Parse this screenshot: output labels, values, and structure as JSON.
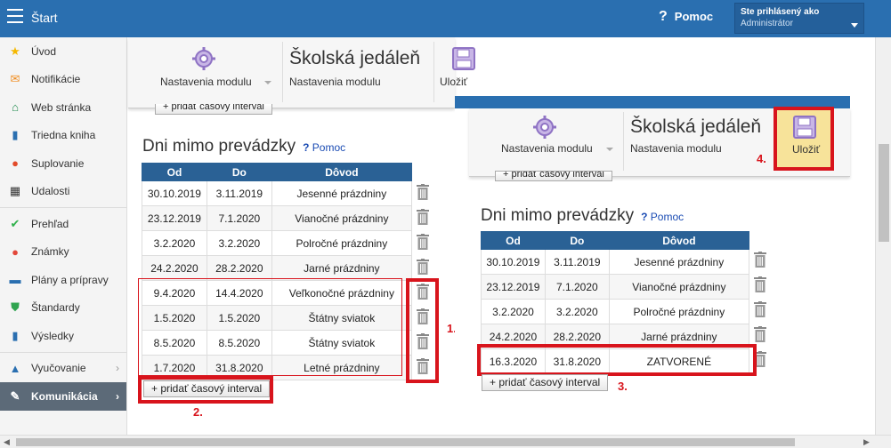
{
  "topbar": {
    "title": "Štart",
    "help_label": "Pomoc",
    "user_label": "Ste prihlásený ako",
    "user_name": "Administrátor"
  },
  "sidebar": {
    "items": [
      {
        "label": "Úvod",
        "icon": "star-icon"
      },
      {
        "label": "Notifikácie",
        "icon": "envelope-icon"
      },
      {
        "label": "Web stránka",
        "icon": "house-icon"
      },
      {
        "label": "Triedna kniha",
        "icon": "book-icon"
      },
      {
        "label": "Suplovanie",
        "icon": "person-icon"
      },
      {
        "label": "Udalosti",
        "icon": "calendar-icon"
      },
      {
        "label": "Prehľad",
        "icon": "check-circle-icon"
      },
      {
        "label": "Známky",
        "icon": "grade-icon"
      },
      {
        "label": "Plány a prípravy",
        "icon": "briefcase-icon"
      },
      {
        "label": "Štandardy",
        "icon": "shield-icon"
      },
      {
        "label": "Výsledky",
        "icon": "bar-chart-icon"
      },
      {
        "label": "Vyučovanie",
        "icon": "graduation-icon"
      },
      {
        "label": "Komunikácia",
        "icon": "chat-icon"
      }
    ]
  },
  "module": {
    "settings_label": "Nastavenia modulu",
    "title": "Školská jedáleň",
    "subtitle": "Nastavenia modulu",
    "save_label": "Uložiť"
  },
  "section": {
    "title": "Dni mimo prevádzky",
    "help_label": "Pomoc",
    "columns": [
      "Od",
      "Do",
      "Dôvod"
    ],
    "add_button": "+ pridať časový interval"
  },
  "left_table": [
    [
      "30.10.2019",
      "3.11.2019",
      "Jesenné prázdniny"
    ],
    [
      "23.12.2019",
      "7.1.2020",
      "Vianočné prázdniny"
    ],
    [
      "3.2.2020",
      "3.2.2020",
      "Polročné prázdniny"
    ],
    [
      "24.2.2020",
      "28.2.2020",
      "Jarné prázdniny"
    ],
    [
      "9.4.2020",
      "14.4.2020",
      "Veľkonočné prázdniny"
    ],
    [
      "1.5.2020",
      "1.5.2020",
      "Štátny sviatok"
    ],
    [
      "8.5.2020",
      "8.5.2020",
      "Štátny sviatok"
    ],
    [
      "1.7.2020",
      "31.8.2020",
      "Letné prázdniny"
    ]
  ],
  "right_table": [
    [
      "30.10.2019",
      "3.11.2019",
      "Jesenné prázdniny"
    ],
    [
      "23.12.2019",
      "7.1.2020",
      "Vianočné prázdniny"
    ],
    [
      "3.2.2020",
      "3.2.2020",
      "Polročné prázdniny"
    ],
    [
      "24.2.2020",
      "28.2.2020",
      "Jarné prázdniny"
    ],
    [
      "16.3.2020",
      "31.8.2020",
      "ZATVORENÉ"
    ]
  ],
  "markers": {
    "m1": "1.",
    "m2": "2.",
    "m3": "3.",
    "m4": "4."
  },
  "colors": {
    "accent": "#2a6fb0",
    "header": "#2a6195",
    "highlight": "#d8141c",
    "save_bg": "#f7e39a"
  }
}
